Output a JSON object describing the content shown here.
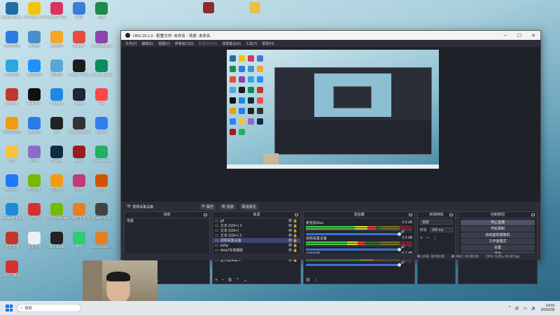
{
  "desktop": {
    "top_icons": [
      {
        "label": "",
        "color": "#c0392b"
      },
      {
        "label": "",
        "color": "#e8c04a"
      }
    ],
    "icons": [
      {
        "label": "AutoDesktop...",
        "color": "#1d6fa5"
      },
      {
        "label": "PotPlayer 64 bit",
        "color": "#f1c40f"
      },
      {
        "label": "SteamGirl 音...",
        "color": "#d9345f"
      },
      {
        "label": "辅助",
        "color": "#3b7dd8"
      },
      {
        "label": "表格",
        "color": "#1e8a4c"
      },
      {
        "label": "QQ浏览器",
        "color": "#2d7be0"
      },
      {
        "label": "此电脑",
        "color": "#4a90c8"
      },
      {
        "label": "360安全",
        "color": "#f5a623"
      },
      {
        "label": "Quicker",
        "color": "#e74c3c"
      },
      {
        "label": "MASR编辑器",
        "color": "#8e44ad"
      },
      {
        "label": "哔哩哔哩",
        "color": "#2ea7e0"
      },
      {
        "label": "腾讯视频",
        "color": "#1e90ff"
      },
      {
        "label": "回收站",
        "color": "#5aa7d6"
      },
      {
        "label": "Razer Cortex",
        "color": "#1b1b1b"
      },
      {
        "label": "Microsoft Edge",
        "color": "#0b8c5f"
      },
      {
        "label": "WeMod",
        "color": "#c0392b"
      },
      {
        "label": "GeForce",
        "color": "#111111"
      },
      {
        "label": "Vagrant",
        "color": "#1e88e5"
      },
      {
        "label": "Steam",
        "color": "#1b2838"
      },
      {
        "label": "EA",
        "color": "#ff4747"
      },
      {
        "label": "网易云音乐",
        "color": "#f39c12"
      },
      {
        "label": "QQ音乐",
        "color": "#2c7be5"
      },
      {
        "label": "KK",
        "color": "#222222"
      },
      {
        "label": "Street Fighter 6",
        "color": "#333333"
      },
      {
        "label": "ToDesk",
        "color": "#2f80ed"
      },
      {
        "label": "QQ",
        "color": "#f6c244"
      },
      {
        "label": "原神",
        "color": "#8e6bc9"
      },
      {
        "label": "DeepL",
        "color": "#0f2b46"
      },
      {
        "label": "Apex",
        "color": "#9b1c1c"
      },
      {
        "label": "Everything",
        "color": "#27ae60"
      },
      {
        "label": "腾讯会议",
        "color": "#2176ff"
      },
      {
        "label": "NVIDIA",
        "color": "#76b900"
      },
      {
        "label": "CODM",
        "color": "#f39c12"
      },
      {
        "label": "崩坏",
        "color": "#c0397b"
      },
      {
        "label": "游戏",
        "color": "#d35400"
      },
      {
        "label": "Microsoft Edge",
        "color": "#1e8bd6"
      },
      {
        "label": "PDF",
        "color": "#d63031"
      },
      {
        "label": "NVIDIA Broadcast",
        "color": "#76b900"
      },
      {
        "label": "火绒安全软件",
        "color": "#e67e22"
      },
      {
        "label": "Maono Link",
        "color": "#444444"
      },
      {
        "label": "游戏直播",
        "color": "#c0392b"
      },
      {
        "label": "文本文档",
        "color": "#ecf0f1"
      },
      {
        "label": "OBS Studio",
        "color": "#222222"
      },
      {
        "label": "微信",
        "color": "#2ecc71"
      },
      {
        "label": "Overcooked Together",
        "color": "#e67e22"
      },
      {
        "label": "WPS Office",
        "color": "#d63031"
      }
    ]
  },
  "obs": {
    "title": "OBS 29.1.3 - 配置文件: 未命名 - 场景: 未命名",
    "menu": [
      {
        "label": "文件(F)",
        "enabled": true
      },
      {
        "label": "编辑(E)",
        "enabled": true
      },
      {
        "label": "视图(V)",
        "enabled": true
      },
      {
        "label": "停靠窗口(D)",
        "enabled": true
      },
      {
        "label": "配置文件(P)",
        "enabled": false
      },
      {
        "label": "场景集合(S)",
        "enabled": true
      },
      {
        "label": "工具(T)",
        "enabled": true
      },
      {
        "label": "帮助(H)",
        "enabled": true
      }
    ],
    "source_toolbar": {
      "selected_source": "视频采集设备",
      "properties": "属性",
      "filters": "滤镜",
      "deactivate": "取消激活"
    },
    "docks": {
      "scenes": {
        "title": "场景",
        "items": [
          "场景"
        ]
      },
      "sources": {
        "title": "来源",
        "items": [
          {
            "name": "gif",
            "selected": false
          },
          {
            "name": "文本 (GDI+) 3",
            "selected": false
          },
          {
            "name": "文本 (GDI+)",
            "selected": false
          },
          {
            "name": "文本 (GDI+) 2",
            "selected": false
          },
          {
            "name": "视频采集设备",
            "selected": true
          },
          {
            "name": "pubg",
            "selected": false
          },
          {
            "name": "dota2专用捕获",
            "selected": false
          },
          {
            "name": "csgo2",
            "selected": false
          },
          {
            "name": "显示器采集 2",
            "selected": false
          }
        ]
      },
      "mixer": {
        "title": "混音器",
        "channels": [
          {
            "name": "麦克风/Aux",
            "db": "0.0 dB",
            "level": 0.66
          },
          {
            "name": "视频采集设备",
            "db": "0.0 dB",
            "level": 0.55
          },
          {
            "name": "桌面音频",
            "db": "-0.2 dB",
            "level": 0.72
          }
        ]
      },
      "transitions": {
        "title": "转场特效",
        "type": "渐变",
        "duration_label": "时长",
        "duration": "300 ms"
      },
      "controls": {
        "title": "控制按钮",
        "buttons": [
          "停止直播",
          "开始录制",
          "启动虚拟摄像机",
          "工作室模式",
          "设置",
          "退出"
        ]
      }
    },
    "status": {
      "live": "LIVE: 00:00:00",
      "rec": "REC: 00:00:00",
      "cpu": "CPU: 0.8%, 60.00 fps"
    }
  },
  "taskbar": {
    "search_placeholder": "搜索",
    "input_lang": "中",
    "time": "14:59",
    "date": "2026/2/8"
  }
}
